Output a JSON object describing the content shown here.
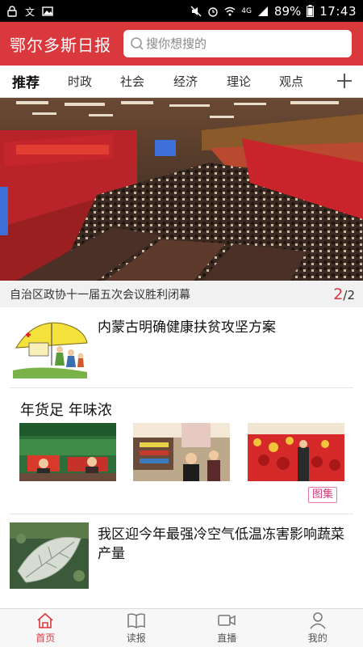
{
  "status_bar": {
    "battery": "89%",
    "time": "17:43",
    "network": "4G"
  },
  "header": {
    "app_title": "鄂尔多斯日报",
    "search_placeholder": "搜你想搜的"
  },
  "tabs": [
    {
      "label": "推荐",
      "active": true
    },
    {
      "label": "时政",
      "active": false
    },
    {
      "label": "社会",
      "active": false
    },
    {
      "label": "经济",
      "active": false
    },
    {
      "label": "理论",
      "active": false
    },
    {
      "label": "观点",
      "active": false
    }
  ],
  "banner": {
    "caption": "自治区政协十一届五次会议胜利闭幕",
    "current": "2",
    "total": "/2"
  },
  "articles": [
    {
      "title": "内蒙古明确健康扶贫攻坚方案"
    },
    {
      "title": "我区迎今年最强冷空气低温冻害影响蔬菜产量"
    }
  ],
  "gallery": {
    "title": "年货足 年味浓",
    "badge": "图集"
  },
  "bottom_nav": [
    {
      "label": "首页",
      "icon": "home-icon",
      "active": true
    },
    {
      "label": "读报",
      "icon": "book-icon",
      "active": false
    },
    {
      "label": "直播",
      "icon": "video-icon",
      "active": false
    },
    {
      "label": "我的",
      "icon": "person-icon",
      "active": false
    }
  ],
  "colors": {
    "brand_red": "#d9383d",
    "gallery_badge": "#d43c7a"
  }
}
